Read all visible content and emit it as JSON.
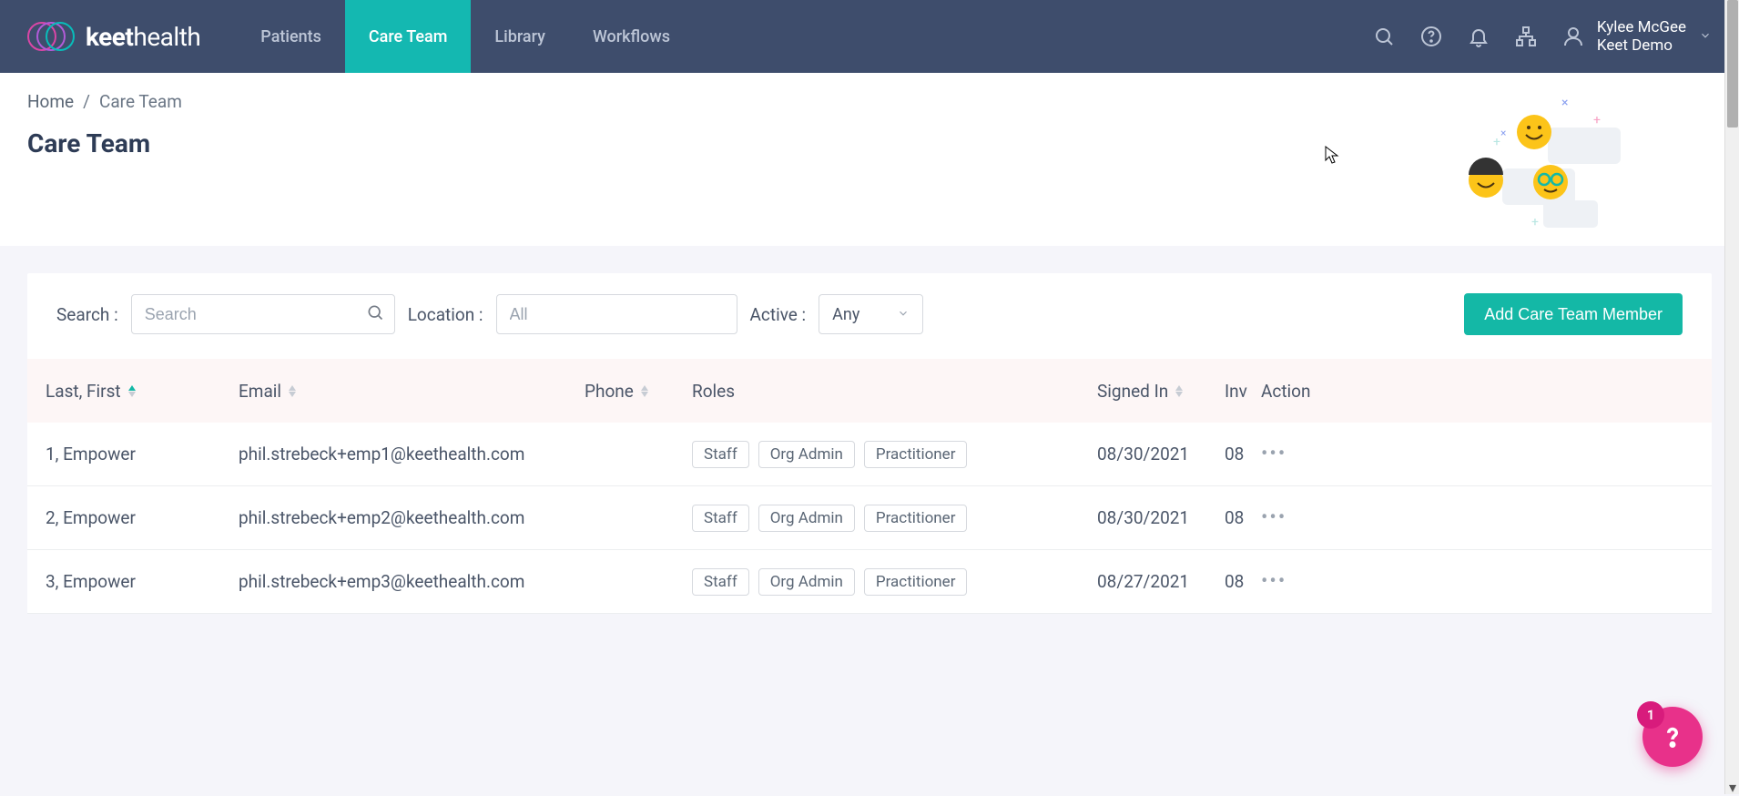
{
  "brand": {
    "name_bold": "keet",
    "name_light": "health"
  },
  "nav": {
    "items": [
      {
        "label": "Patients",
        "active": false
      },
      {
        "label": "Care Team",
        "active": true
      },
      {
        "label": "Library",
        "active": false
      },
      {
        "label": "Workflows",
        "active": false
      }
    ]
  },
  "user": {
    "name": "Kylee McGee",
    "org": "Keet Demo"
  },
  "breadcrumb": {
    "home": "Home",
    "current": "Care Team"
  },
  "page_title": "Care Team",
  "filters": {
    "search_label": "Search :",
    "search_placeholder": "Search",
    "location_label": "Location :",
    "location_placeholder": "All",
    "active_label": "Active :",
    "active_value": "Any"
  },
  "add_button": "Add Care Team Member",
  "columns": {
    "name": "Last, First",
    "email": "Email",
    "phone": "Phone",
    "roles": "Roles",
    "signed": "Signed In",
    "invite": "Inv",
    "action": "Action"
  },
  "rows": [
    {
      "name": "1, Empower",
      "email": "phil.strebeck+emp1@keethealth.com",
      "phone": "",
      "roles": [
        "Staff",
        "Org Admin",
        "Practitioner"
      ],
      "signed": "08/30/2021",
      "invite": "08"
    },
    {
      "name": "2, Empower",
      "email": "phil.strebeck+emp2@keethealth.com",
      "phone": "",
      "roles": [
        "Staff",
        "Org Admin",
        "Practitioner"
      ],
      "signed": "08/30/2021",
      "invite": "08"
    },
    {
      "name": "3, Empower",
      "email": "phil.strebeck+emp3@keethealth.com",
      "phone": "",
      "roles": [
        "Staff",
        "Org Admin",
        "Practitioner"
      ],
      "signed": "08/27/2021",
      "invite": "08"
    }
  ],
  "help_badge": "1"
}
